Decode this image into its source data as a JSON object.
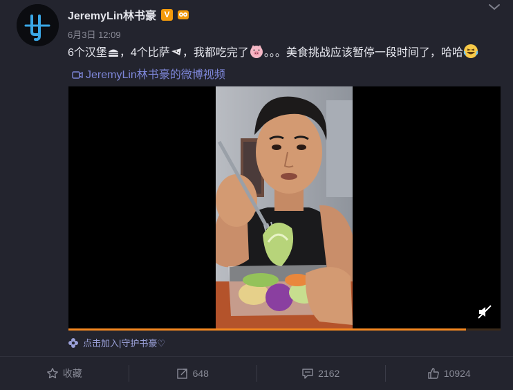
{
  "post": {
    "username": "JeremyLin林书豪",
    "verified_badge": "V",
    "time": "6月3日 12:09",
    "text_part1": "6个汉堡",
    "text_part2": "，4个比萨",
    "text_part3": "，我都吃完了",
    "text_part4": "。。。美食挑战应该暂停一段时间了，哈哈",
    "video_link": "JeremyLin林书豪的微博视频",
    "topic": "点击加入|守护书豪♡"
  },
  "video": {
    "progress": 0.92
  },
  "actions": {
    "favorite_label": "收藏",
    "repost_count": "648",
    "comment_count": "2162",
    "like_count": "10924"
  },
  "icons": {
    "avatar": "jeremy-lin-logo",
    "dropdown": "chevron-down-icon",
    "burger": "burger-emoji",
    "pizza": "pizza-emoji",
    "pig": "pig-emoji",
    "laugh": "laughing-emoji",
    "video": "video-icon",
    "mute": "mute-icon",
    "topic": "flower-icon",
    "star": "star-icon",
    "repost": "repost-icon",
    "comment": "comment-icon",
    "like": "thumbs-up-icon"
  },
  "colors": {
    "link": "#7d86d8",
    "progress": "#f58820",
    "badge": "#f29a0c"
  }
}
